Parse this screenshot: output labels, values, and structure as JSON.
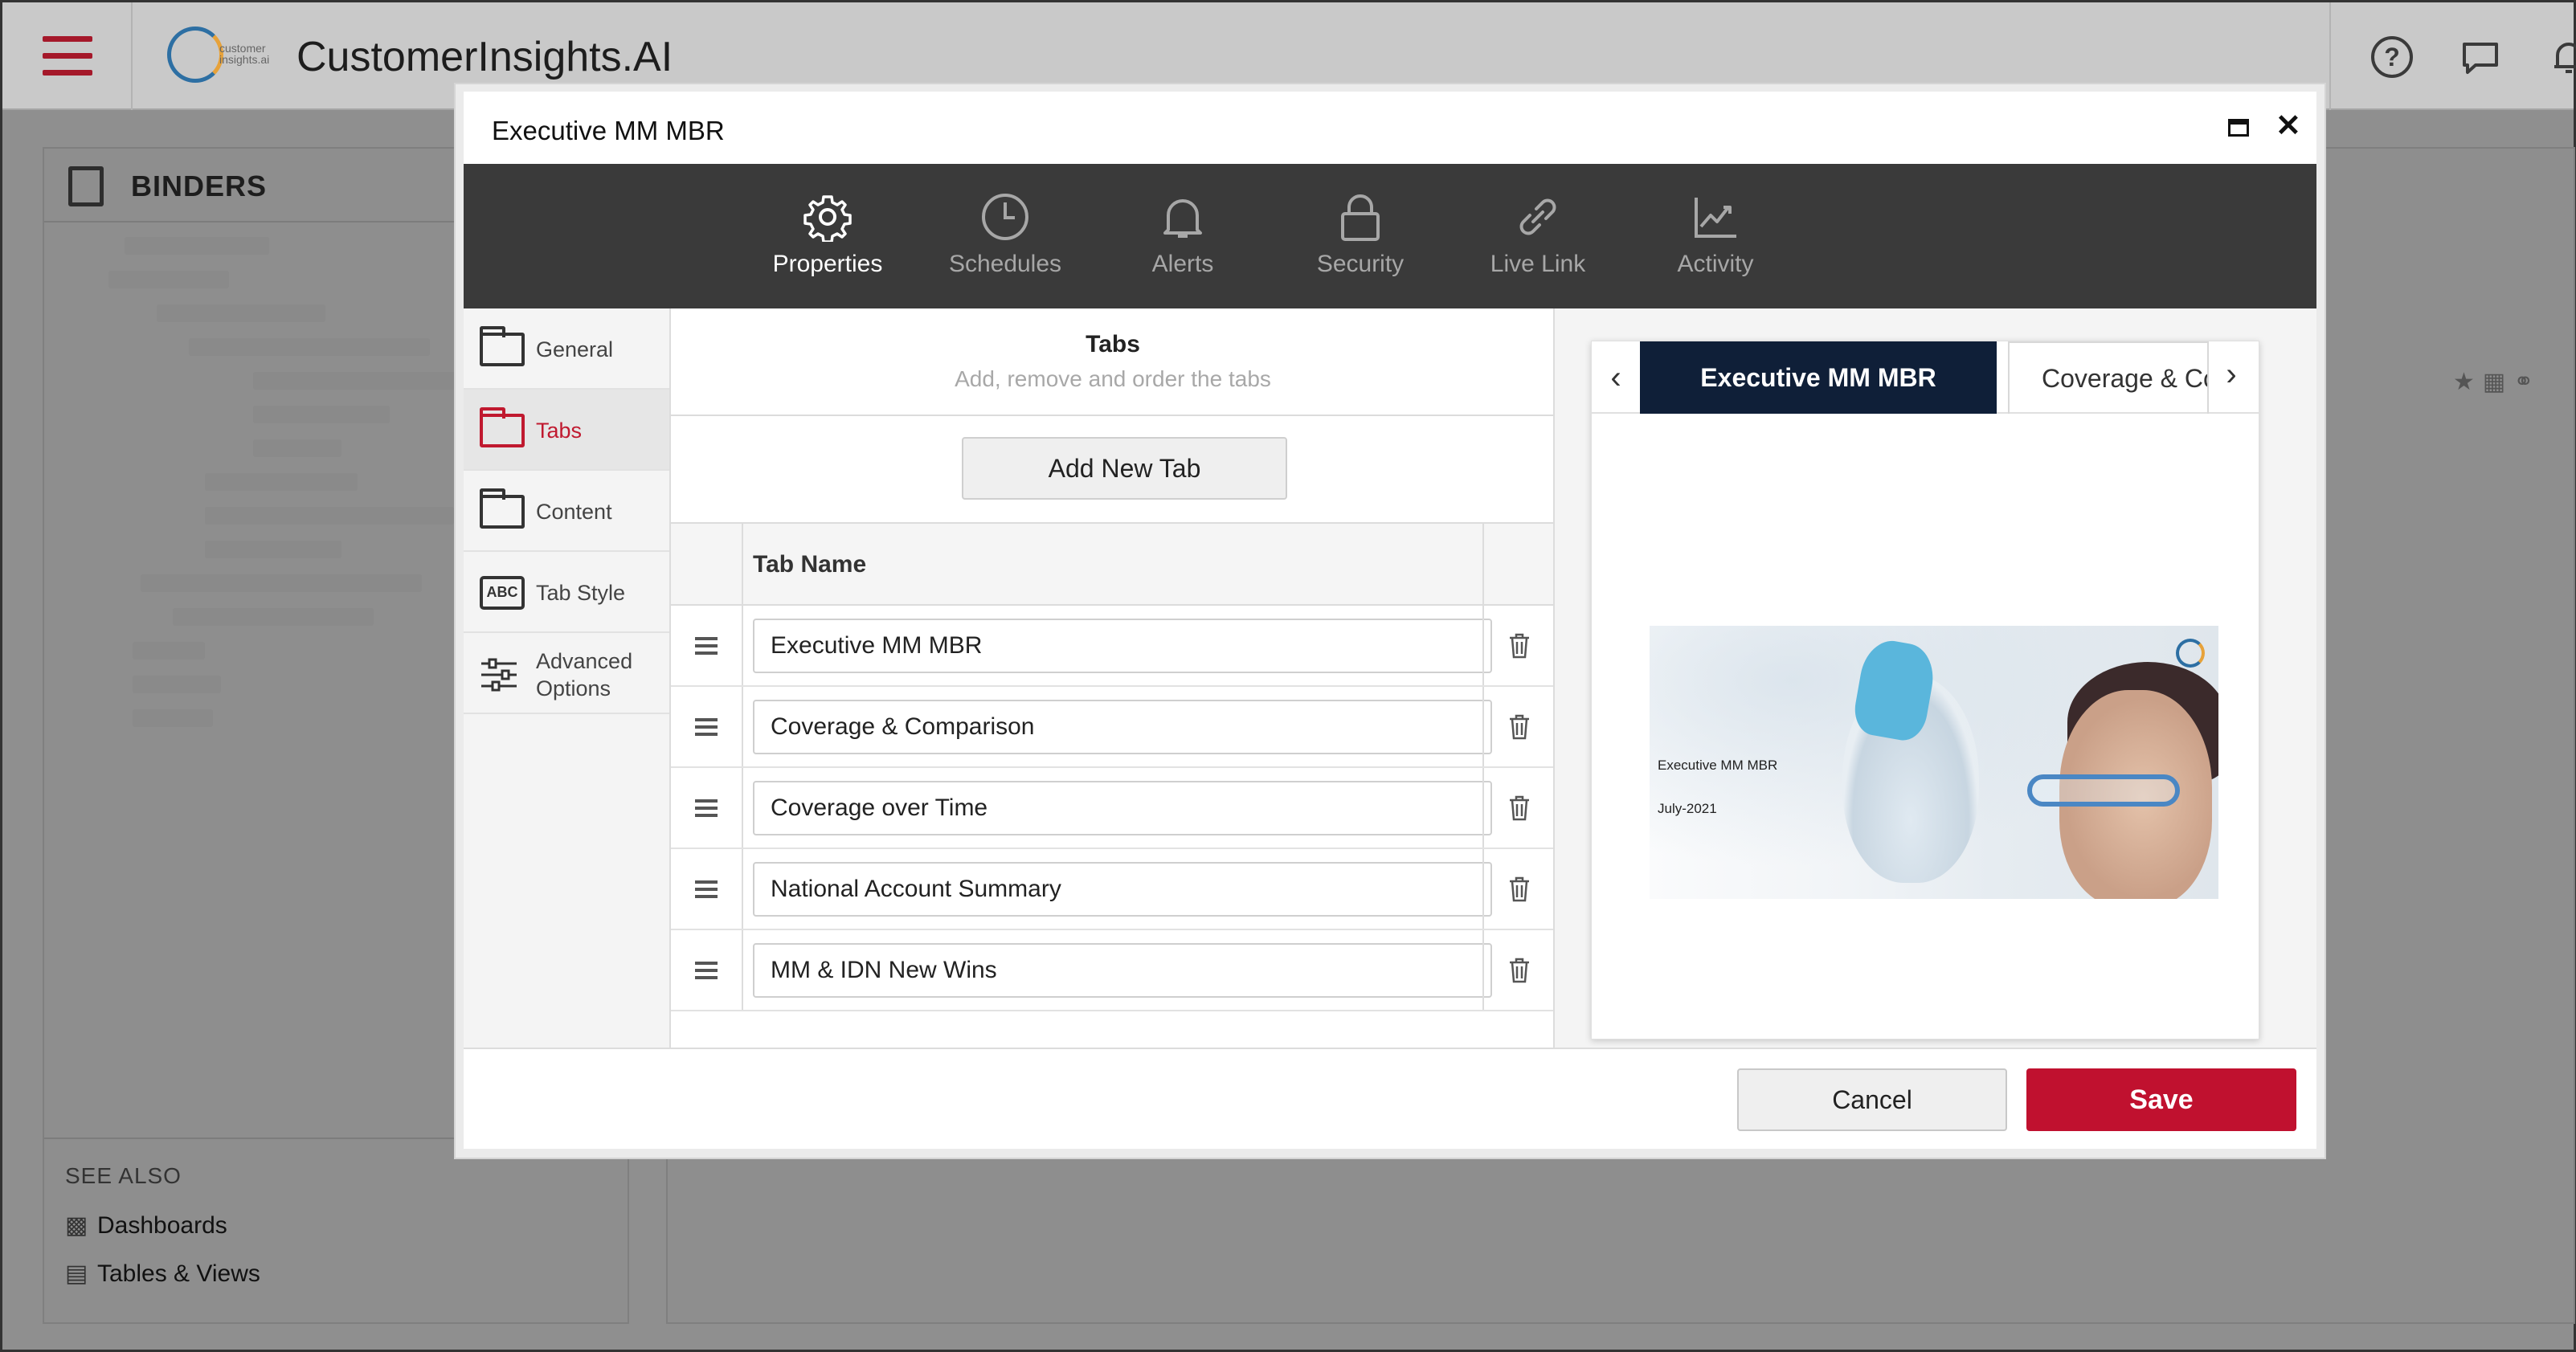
{
  "app": {
    "title": "CustomerInsights.AI",
    "logo_text": "customer insights.ai"
  },
  "left_panel": {
    "title": "BINDERS",
    "see_also_title": "SEE ALSO",
    "see_also": [
      {
        "label": "Dashboards",
        "icon": "bar-chart-icon"
      },
      {
        "label": "Tables & Views",
        "icon": "database-icon"
      }
    ]
  },
  "modal": {
    "title": "Executive MM MBR",
    "toolbar": [
      {
        "label": "Properties",
        "icon": "gear-icon",
        "active": true
      },
      {
        "label": "Schedules",
        "icon": "clock-icon",
        "active": false
      },
      {
        "label": "Alerts",
        "icon": "bell-icon",
        "active": false
      },
      {
        "label": "Security",
        "icon": "lock-icon",
        "active": false
      },
      {
        "label": "Live Link",
        "icon": "link-icon",
        "active": false
      },
      {
        "label": "Activity",
        "icon": "activity-chart-icon",
        "active": false
      }
    ],
    "sidenav": [
      {
        "label": "General",
        "icon": "folder-icon"
      },
      {
        "label": "Tabs",
        "icon": "folder-icon",
        "active": true
      },
      {
        "label": "Content",
        "icon": "folder-icon"
      },
      {
        "label": "Tab Style",
        "icon": "abc-icon"
      },
      {
        "label": "Advanced Options",
        "icon": "sliders-icon"
      }
    ],
    "editor": {
      "title": "Tabs",
      "subtitle": "Add, remove and order the tabs",
      "add_button": "Add New Tab",
      "column_header": "Tab Name",
      "tabs": [
        "Executive MM MBR",
        "Coverage & Comparison",
        "Coverage over Time",
        "National Account Summary",
        "MM & IDN New Wins"
      ]
    },
    "preview": {
      "active_tab": "Executive MM MBR",
      "next_tab": "Coverage & Cc",
      "slide_title": "Executive MM MBR",
      "slide_date": "July-2021"
    },
    "footer": {
      "cancel_label": "Cancel",
      "save_label": "Save"
    }
  },
  "colors": {
    "accent": "#c0112f",
    "toolbar_bg": "#3a3a3a",
    "preview_tab_active": "#0f1f38"
  }
}
